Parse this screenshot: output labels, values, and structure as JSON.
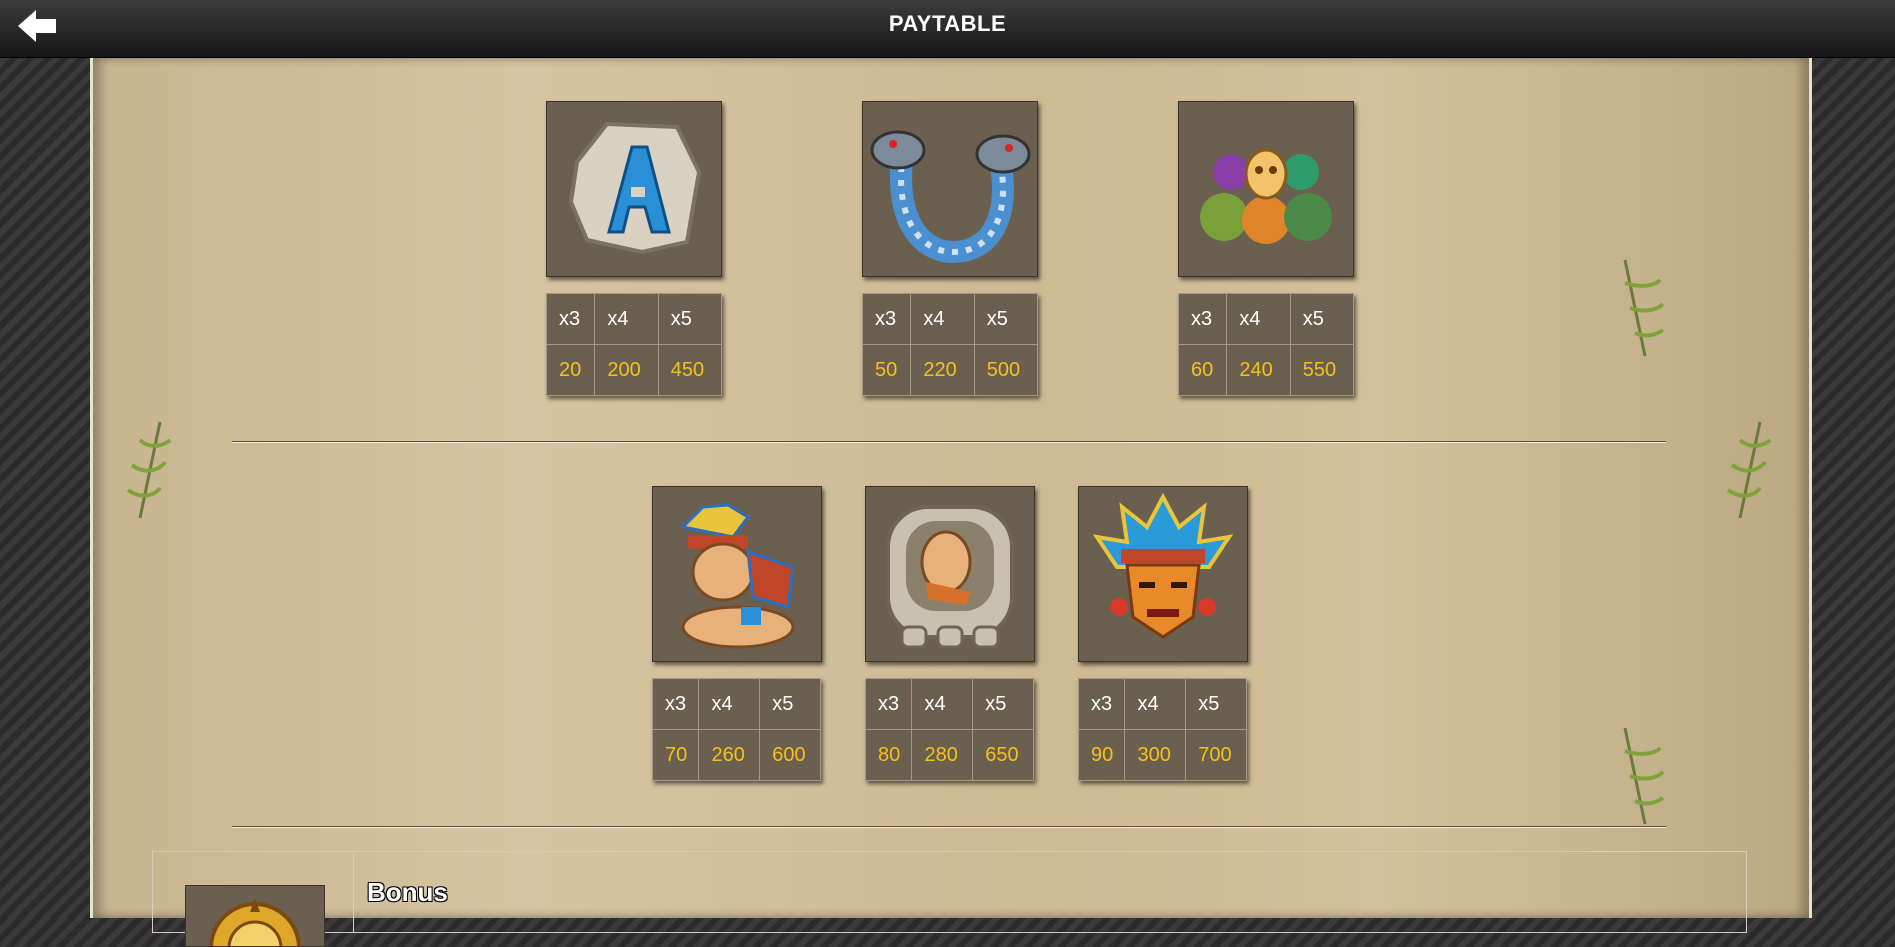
{
  "header": {
    "title": "PAYTABLE",
    "back_icon": "back-arrow-icon"
  },
  "rows": [
    {
      "symbols": [
        {
          "icon": "stone-letter-a-icon",
          "headers": [
            "x3",
            "x4",
            "x5"
          ],
          "payouts": [
            "20",
            "200",
            "450"
          ]
        },
        {
          "icon": "two-headed-serpent-icon",
          "headers": [
            "x3",
            "x4",
            "x5"
          ],
          "payouts": [
            "50",
            "220",
            "500"
          ]
        },
        {
          "icon": "skull-snakes-idol-icon",
          "headers": [
            "x3",
            "x4",
            "x5"
          ],
          "payouts": [
            "60",
            "240",
            "550"
          ]
        }
      ]
    },
    {
      "symbols": [
        {
          "icon": "kneeling-warrior-icon",
          "headers": [
            "x3",
            "x4",
            "x5"
          ],
          "payouts": [
            "70",
            "260",
            "600"
          ]
        },
        {
          "icon": "stone-glyph-figure-icon",
          "headers": [
            "x3",
            "x4",
            "x5"
          ],
          "payouts": [
            "80",
            "280",
            "650"
          ]
        },
        {
          "icon": "feathered-chief-mask-icon",
          "headers": [
            "x3",
            "x4",
            "x5"
          ],
          "payouts": [
            "90",
            "300",
            "700"
          ]
        }
      ]
    }
  ],
  "bonus": {
    "title": "Bonus",
    "icon": "golden-sun-disc-icon"
  },
  "colors": {
    "payout_value": "#f2c21a",
    "tile_background": "#6b604f",
    "parchment": "#d6c5a2"
  }
}
